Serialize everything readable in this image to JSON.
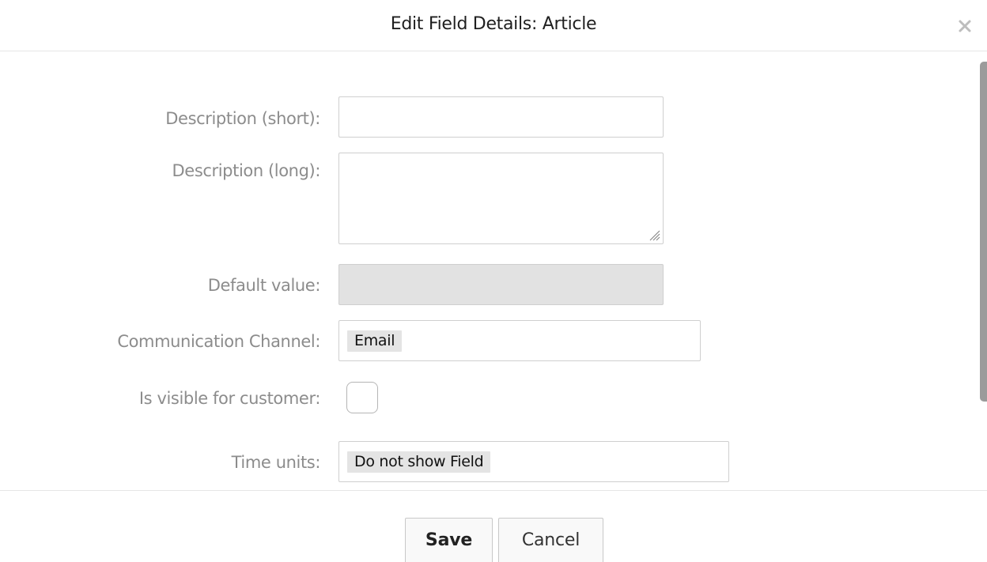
{
  "dialog": {
    "title": "Edit Field Details: Article",
    "close_icon": "close-icon"
  },
  "form": {
    "description_short": {
      "label": "Description (short):",
      "value": ""
    },
    "description_long": {
      "label": "Description (long):",
      "value": ""
    },
    "default_value": {
      "label": "Default value:",
      "value": "",
      "disabled": true
    },
    "communication_channel": {
      "label": "Communication Channel:",
      "selected": "Email"
    },
    "is_visible_for_customer": {
      "label": "Is visible for customer:",
      "checked": false
    },
    "time_units": {
      "label": "Time units:",
      "selected": "Do not show Field"
    }
  },
  "footer": {
    "save_label": "Save",
    "cancel_label": "Cancel"
  }
}
